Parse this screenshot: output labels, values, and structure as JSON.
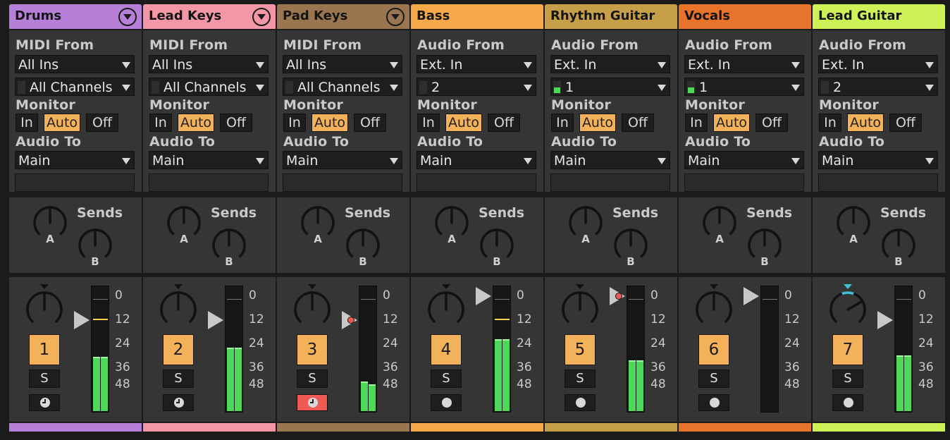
{
  "colors": {
    "accent_orange": "#f3b25a",
    "meter_green": "#4ed85a",
    "arm_red": "#f05a55",
    "send_knob_active": "#3fc2d6"
  },
  "labels": {
    "monitor": "Monitor",
    "audio_to": "Audio To",
    "sends": "Sends",
    "send_a": "A",
    "send_b": "B",
    "monitor_in": "In",
    "monitor_auto": "Auto",
    "monitor_off": "Off",
    "solo": "S",
    "scale": [
      "0",
      "12",
      "24",
      "36",
      "48"
    ]
  },
  "tracks": [
    {
      "name": "Drums",
      "color": "#b67fd8",
      "has_fold": true,
      "input_type_label": "MIDI From",
      "input_source": "All Ins",
      "input_channel": "All Channels",
      "channel_meter": false,
      "monitor": "Auto",
      "output": "Main",
      "number": "1",
      "record_icon": "clock-icon",
      "armed": false,
      "pan_icon": "pan-knob-icon",
      "meter_level_fraction": 0.44,
      "peak_db_marker": 12,
      "fader_db": 12
    },
    {
      "name": "Lead Keys",
      "color": "#f397a7",
      "has_fold": true,
      "input_type_label": "MIDI From",
      "input_source": "All Ins",
      "input_channel": "All Channels",
      "channel_meter": false,
      "monitor": "Auto",
      "output": "Main",
      "number": "2",
      "record_icon": "clock-icon",
      "armed": false,
      "pan_icon": "pan-knob-icon",
      "meter_level_fraction": 0.51,
      "peak_db_marker": null,
      "fader_db": 12
    },
    {
      "name": "Pad Keys",
      "color": "#9a7650",
      "has_fold": true,
      "input_type_label": "MIDI From",
      "input_source": "All Ins",
      "input_channel": "All Channels",
      "channel_meter": false,
      "monitor": "Auto",
      "output": "Main",
      "number": "3",
      "record_icon": "clock-icon",
      "armed": true,
      "pan_icon": "pan-knob-icon",
      "meter_level_fraction": 0.24,
      "peak_db_marker": null,
      "fader_db": 12
    },
    {
      "name": "Bass",
      "color": "#f6a948",
      "has_fold": false,
      "input_type_label": "Audio From",
      "input_source": "Ext. In",
      "input_channel": "2",
      "channel_meter": false,
      "monitor": "Auto",
      "output": "Main",
      "number": "4",
      "record_icon": "record-dot-icon",
      "armed": false,
      "pan_icon": "pan-knob-icon",
      "meter_level_fraction": 0.58,
      "peak_db_marker": 12,
      "fader_db": 0
    },
    {
      "name": "Rhythm Guitar",
      "color": "#c79f48",
      "has_fold": false,
      "input_type_label": "Audio From",
      "input_source": "Ext. In",
      "input_channel": "1",
      "channel_meter": true,
      "monitor": "Auto",
      "output": "Main",
      "number": "5",
      "record_icon": "record-dot-icon",
      "armed": false,
      "pan_icon": "pan-knob-icon",
      "meter_level_fraction": 0.41,
      "peak_db_marker": null,
      "fader_db": 0
    },
    {
      "name": "Vocals",
      "color": "#e8742c",
      "has_fold": false,
      "input_type_label": "Audio From",
      "input_source": "Ext. In",
      "input_channel": "1",
      "channel_meter": true,
      "monitor": "Auto",
      "output": "Main",
      "number": "6",
      "record_icon": "record-dot-icon",
      "armed": false,
      "pan_icon": "pan-knob-icon",
      "meter_level_fraction": 0.0,
      "peak_db_marker": null,
      "fader_db": 0
    },
    {
      "name": "Lead Guitar",
      "color": "#cdf257",
      "has_fold": false,
      "input_type_label": "Audio From",
      "input_source": "Ext. In",
      "input_channel": "2",
      "channel_meter": false,
      "monitor": "Auto",
      "output": "Main",
      "number": "7",
      "record_icon": "record-dot-icon",
      "armed": false,
      "pan_icon": "pan-knob-icon",
      "pan_right": true,
      "meter_level_fraction": 0.45,
      "peak_db_marker": null,
      "fader_db": 12
    }
  ]
}
